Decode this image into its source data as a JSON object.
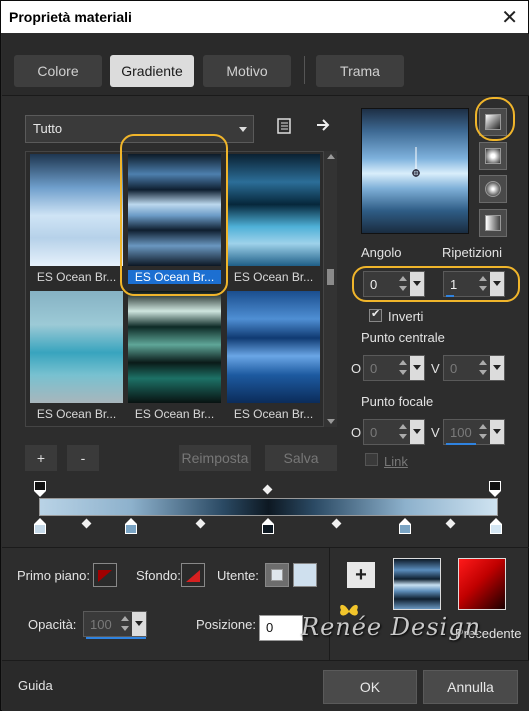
{
  "window": {
    "title": "Proprietà materiali",
    "close": "✕"
  },
  "tabs": [
    {
      "label": "Colore"
    },
    {
      "label": "Gradiente"
    },
    {
      "label": "Motivo"
    },
    {
      "label": "Trama"
    }
  ],
  "category": {
    "value": "Tutto"
  },
  "gallery": {
    "items": [
      {
        "label": "ES Ocean Br..."
      },
      {
        "label": "ES Ocean Br..."
      },
      {
        "label": "ES Ocean Br..."
      },
      {
        "label": "ES Ocean Br..."
      },
      {
        "label": "ES Ocean Br..."
      },
      {
        "label": "ES Ocean Br..."
      }
    ]
  },
  "buttons": {
    "add": "+",
    "remove": "-",
    "reset": "Reimposta",
    "save": "Salva"
  },
  "controls": {
    "angle_label": "Angolo",
    "angle_value": "0",
    "repeat_label": "Ripetizioni",
    "repeat_value": "1",
    "invert_label": "Inverti",
    "center_label": "Punto centrale",
    "focal_label": "Punto focale",
    "o_label": "O",
    "v_label": "V",
    "center_o": "0",
    "center_v": "0",
    "focal_o": "0",
    "focal_v": "100",
    "link_label": "Link"
  },
  "bottom": {
    "foreground_label": "Primo piano:",
    "background_label": "Sfondo:",
    "user_label": "Utente:",
    "opacity_label": "Opacità:",
    "opacity_value": "100",
    "position_label": "Posizione:",
    "position_value": "0",
    "plus": "+",
    "previous_label": "Precedente"
  },
  "watermark": "Renée Design",
  "footer": {
    "help": "Guida",
    "ok": "OK",
    "cancel": "Annulla"
  },
  "colors": {
    "accent": "#f0b52b",
    "selected": "#1c6fd1"
  }
}
